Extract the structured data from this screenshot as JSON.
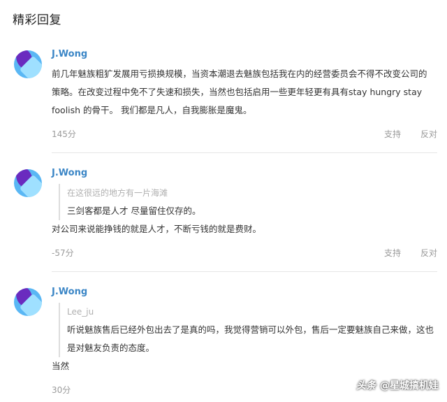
{
  "section_title": "精彩回复",
  "comments": [
    {
      "username": "J.Wong",
      "text": "前几年魅族粗犷发展用亏损换规模，当资本潮退去魅族包括我在内的经营委员会不得不改变公司的策略。在改变过程中免不了失速和损失，当然也包括启用一些更年轻更有具有stay hungry stay foolish 的骨干。 我们都是凡人，自我膨胀是魔鬼。",
      "score": "145分",
      "support": "支持",
      "oppose": "反对"
    },
    {
      "username": "J.Wong",
      "quote_user": "在这很远的地方有一片海滩",
      "quote_text": "三剑客都是人才 尽量留住仅存的。",
      "text": "对公司来说能挣钱的就是人才，不断亏钱的就是费财。",
      "score": "-57分",
      "support": "支持",
      "oppose": "反对"
    },
    {
      "username": "J.Wong",
      "quote_user": "Lee_ju",
      "quote_text": "听说魅族售后已经外包出去了是真的吗，我觉得营销可以外包，售后一定要魅族自己来做，这也是对魅友负责的态度。",
      "text": "当然",
      "score": "30分"
    }
  ],
  "watermark": {
    "brand": "头条",
    "account": "@星城搞机娃"
  },
  "colors": {
    "username": "#3b86c6",
    "meta": "#9a9a9a",
    "avatar_bg": "#5ab7f4",
    "avatar_accent": "#6a2bbf"
  }
}
